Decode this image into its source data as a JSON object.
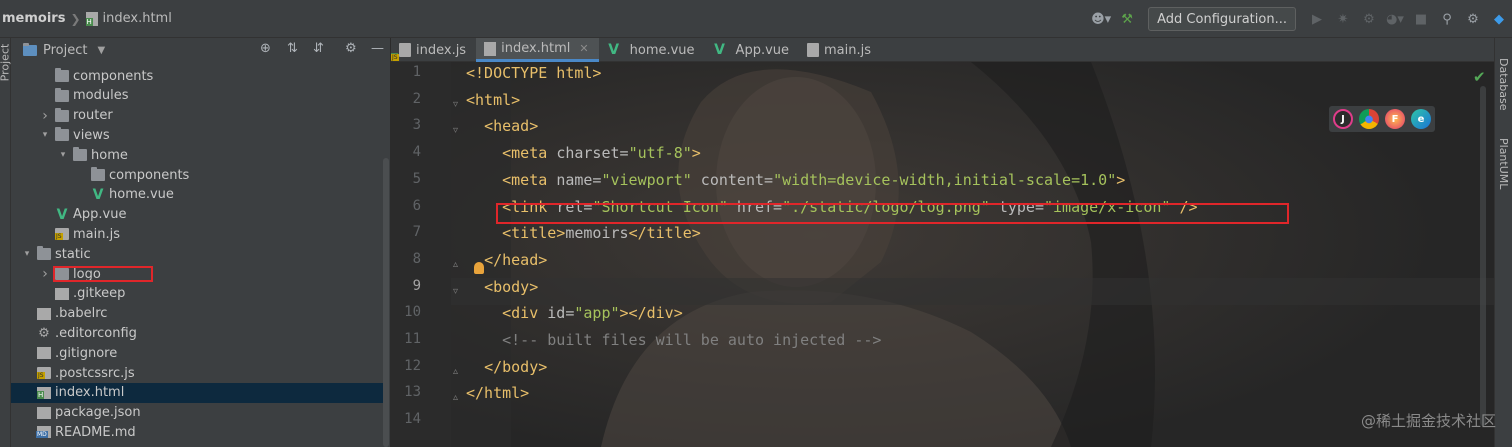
{
  "breadcrumb": {
    "root": "memoirs",
    "file": "index.html"
  },
  "toolbar": {
    "add_configuration": "Add Configuration..."
  },
  "left_strip": {
    "label": "Project"
  },
  "project_panel": {
    "title": "Project",
    "tree": [
      {
        "label": "components",
        "type": "folder",
        "depth": 2,
        "expanded": null
      },
      {
        "label": "modules",
        "type": "folder",
        "depth": 2,
        "expanded": null
      },
      {
        "label": "router",
        "type": "folder",
        "depth": 2,
        "expanded": false
      },
      {
        "label": "views",
        "type": "folder",
        "depth": 2,
        "expanded": true
      },
      {
        "label": "home",
        "type": "folder",
        "depth": 3,
        "expanded": true
      },
      {
        "label": "components",
        "type": "folder",
        "depth": 4,
        "expanded": null
      },
      {
        "label": "home.vue",
        "type": "vue",
        "depth": 4,
        "expanded": null
      },
      {
        "label": "App.vue",
        "type": "vue",
        "depth": 2,
        "expanded": null
      },
      {
        "label": "main.js",
        "type": "js",
        "depth": 2,
        "expanded": null
      },
      {
        "label": "static",
        "type": "folder",
        "depth": 1,
        "expanded": true
      },
      {
        "label": "logo",
        "type": "folder",
        "depth": 2,
        "expanded": false
      },
      {
        "label": ".gitkeep",
        "type": "file",
        "depth": 2,
        "expanded": null
      },
      {
        "label": ".babelrc",
        "type": "file",
        "depth": 1,
        "expanded": null
      },
      {
        "label": ".editorconfig",
        "type": "gear",
        "depth": 1,
        "expanded": null
      },
      {
        "label": ".gitignore",
        "type": "file",
        "depth": 1,
        "expanded": null
      },
      {
        "label": ".postcssrc.js",
        "type": "js",
        "depth": 1,
        "expanded": null
      },
      {
        "label": "index.html",
        "type": "html",
        "depth": 1,
        "expanded": null,
        "selected": true
      },
      {
        "label": "package.json",
        "type": "json",
        "depth": 1,
        "expanded": null
      },
      {
        "label": "README.md",
        "type": "md",
        "depth": 1,
        "expanded": null
      }
    ]
  },
  "tabs": [
    {
      "label": "index.js",
      "icon": "js"
    },
    {
      "label": "index.html",
      "icon": "html",
      "active": true
    },
    {
      "label": "home.vue",
      "icon": "vue"
    },
    {
      "label": "App.vue",
      "icon": "vue"
    },
    {
      "label": "main.js",
      "icon": "js"
    }
  ],
  "editor": {
    "current_line": 9,
    "lines": [
      {
        "n": "1",
        "parts": [
          [
            "t",
            "<!DOCTYPE html>"
          ]
        ]
      },
      {
        "n": "2",
        "parts": [
          [
            "t",
            "<html>"
          ]
        ]
      },
      {
        "n": "3",
        "parts": [
          [
            "a",
            "  "
          ],
          [
            "t",
            "<head>"
          ]
        ]
      },
      {
        "n": "4",
        "parts": [
          [
            "a",
            "    "
          ],
          [
            "t",
            "<meta "
          ],
          [
            "a",
            "charset="
          ],
          [
            "s",
            "\"utf-8\""
          ],
          [
            "t",
            ">"
          ]
        ]
      },
      {
        "n": "5",
        "parts": [
          [
            "a",
            "    "
          ],
          [
            "t",
            "<meta "
          ],
          [
            "a",
            "name="
          ],
          [
            "s",
            "\"viewport\""
          ],
          [
            "a",
            " content="
          ],
          [
            "s",
            "\"width=device-width,initial-scale=1.0\""
          ],
          [
            "t",
            ">"
          ]
        ]
      },
      {
        "n": "6",
        "parts": [
          [
            "a",
            "    "
          ],
          [
            "t",
            "<link "
          ],
          [
            "a",
            "rel="
          ],
          [
            "s",
            "\"Shortcut Icon\""
          ],
          [
            "a",
            " href="
          ],
          [
            "s",
            "\"./static/logo/log.png\""
          ],
          [
            "a",
            " type="
          ],
          [
            "s",
            "\"image/x-icon\""
          ],
          [
            "t",
            " />"
          ]
        ]
      },
      {
        "n": "7",
        "parts": [
          [
            "a",
            "    "
          ],
          [
            "t",
            "<title>"
          ],
          [
            "a",
            "memoirs"
          ],
          [
            "t",
            "</title>"
          ]
        ]
      },
      {
        "n": "8",
        "parts": [
          [
            "a",
            "  "
          ],
          [
            "t",
            "</head>"
          ]
        ]
      },
      {
        "n": "9",
        "parts": [
          [
            "a",
            "  "
          ],
          [
            "t",
            "<body>"
          ]
        ]
      },
      {
        "n": "10",
        "parts": [
          [
            "a",
            "    "
          ],
          [
            "t",
            "<div "
          ],
          [
            "a",
            "id="
          ],
          [
            "s",
            "\"app\""
          ],
          [
            "t",
            "></div>"
          ]
        ]
      },
      {
        "n": "11",
        "parts": [
          [
            "a",
            "    "
          ],
          [
            "c",
            "<!-- built files will be auto injected -->"
          ]
        ]
      },
      {
        "n": "12",
        "parts": [
          [
            "a",
            "  "
          ],
          [
            "t",
            "</body>"
          ]
        ]
      },
      {
        "n": "13",
        "parts": [
          [
            "t",
            "</html>"
          ]
        ]
      },
      {
        "n": "14",
        "parts": []
      }
    ]
  },
  "browser_icons": [
    "jetbrains-icon",
    "chrome-icon",
    "firefox-icon",
    "edge-icon"
  ],
  "right_strip": {
    "database": "Database",
    "plantuml": "PlantUML"
  },
  "watermark": "@稀土掘金技术社区",
  "colors": {
    "highlight_box": "#e0262a",
    "tag": "#e8bf6a",
    "string": "#a5c25c",
    "comment": "#808080",
    "selection": "#0d293e"
  }
}
